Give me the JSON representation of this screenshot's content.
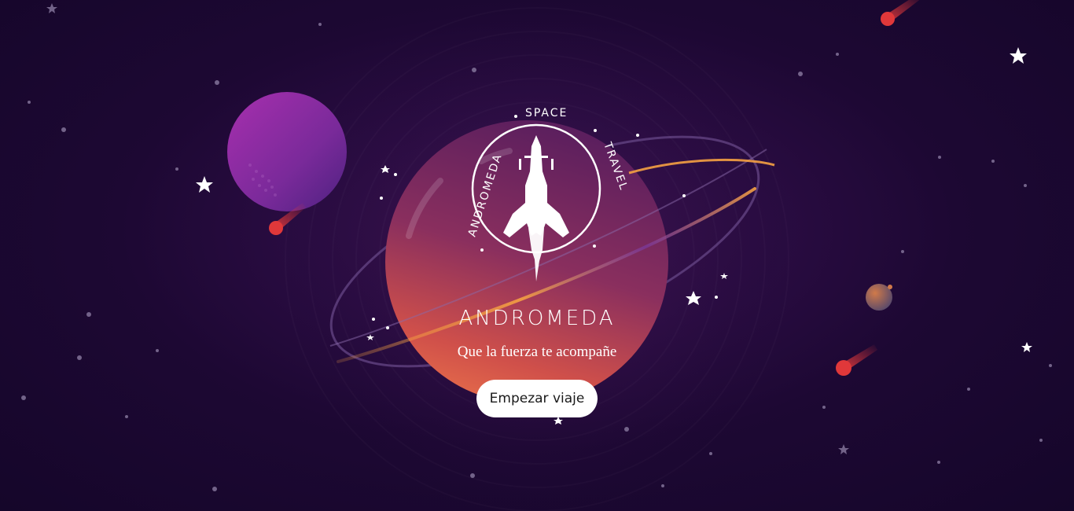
{
  "logo": {
    "ring_text_left": "ANDROMEDA",
    "ring_text_top": "SPACE",
    "ring_text_right": "TRAVEL",
    "icon": "rocket-icon"
  },
  "hero": {
    "title": "ANDROMEDA",
    "tagline": "Que la fuerza te acompañe",
    "cta_label": "Empezar viaje"
  },
  "colors": {
    "background": "#1d0833",
    "planet_purple": "#8e2aa8",
    "planet_main_top": "#6a2a6a",
    "planet_main_bottom": "#e0604a",
    "ring_orange": "#f5a142",
    "meteor": "#e0383a",
    "button_bg": "#ffffff"
  }
}
